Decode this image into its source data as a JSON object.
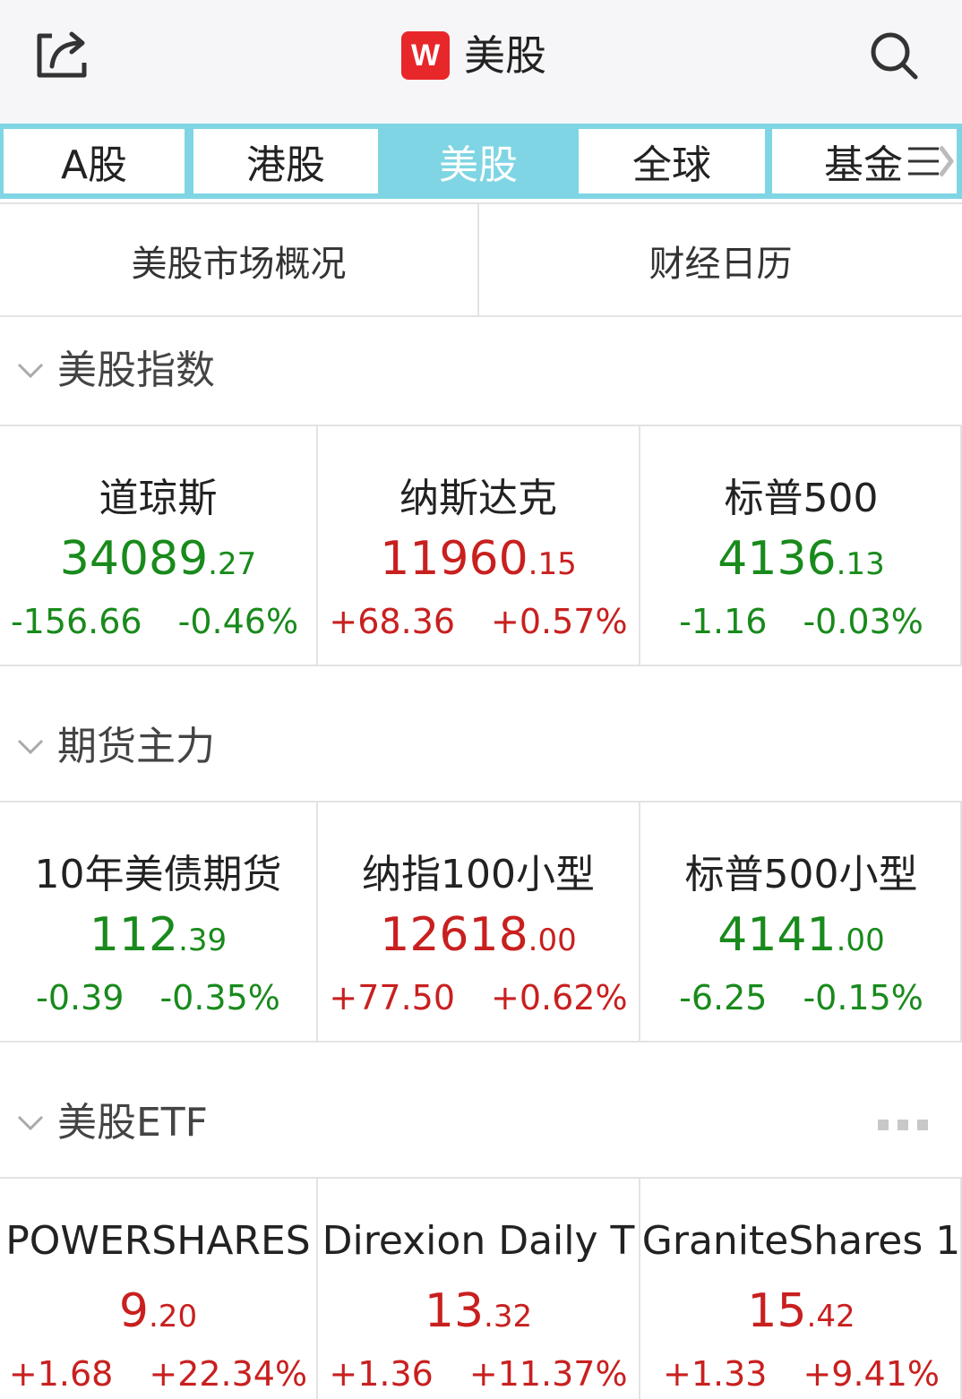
{
  "header": {
    "title": "美股",
    "logo_text": "W",
    "share_icon": "share-icon",
    "search_icon": "search-icon"
  },
  "tabs": [
    {
      "label": "A股",
      "active": false
    },
    {
      "label": "港股",
      "active": false
    },
    {
      "label": "美股",
      "active": true
    },
    {
      "label": "全球",
      "active": false
    },
    {
      "label": "基金",
      "active": false
    }
  ],
  "subnav": {
    "overview": "美股市场概况",
    "calendar": "财经日历"
  },
  "sections": {
    "indices": {
      "title": "美股指数",
      "items": [
        {
          "name": "道琼斯",
          "price_int": "34089",
          "price_dec": ".27",
          "change": "-156.66",
          "percent": "-0.46%",
          "direction": "down"
        },
        {
          "name": "纳斯达克",
          "price_int": "11960",
          "price_dec": ".15",
          "change": "+68.36",
          "percent": "+0.57%",
          "direction": "up"
        },
        {
          "name": "标普500",
          "price_int": "4136",
          "price_dec": ".13",
          "change": "-1.16",
          "percent": "-0.03%",
          "direction": "down"
        }
      ]
    },
    "futures": {
      "title": "期货主力",
      "items": [
        {
          "name": "10年美债期货",
          "price_int": "112",
          "price_dec": ".39",
          "change": "-0.39",
          "percent": "-0.35%",
          "direction": "down"
        },
        {
          "name": "纳指100小型",
          "price_int": "12618",
          "price_dec": ".00",
          "change": "+77.50",
          "percent": "+0.62%",
          "direction": "up"
        },
        {
          "name": "标普500小型",
          "price_int": "4141",
          "price_dec": ".00",
          "change": "-6.25",
          "percent": "-0.15%",
          "direction": "down"
        }
      ]
    },
    "etf": {
      "title": "美股ETF",
      "items": [
        {
          "name": "POWERSHARES",
          "price_int": "9",
          "price_dec": ".20",
          "change": "+1.68",
          "percent": "+22.34%",
          "direction": "up"
        },
        {
          "name": "Direxion Daily T",
          "price_int": "13",
          "price_dec": ".32",
          "change": "+1.36",
          "percent": "+11.37%",
          "direction": "up"
        },
        {
          "name": "GraniteShares 1",
          "price_int": "15",
          "price_dec": ".42",
          "change": "+1.33",
          "percent": "+9.41%",
          "direction": "up"
        }
      ]
    }
  },
  "colors": {
    "up": "#c8201f",
    "down": "#198a1c",
    "tab_accent": "#7fd5e3",
    "logo_bg": "#e8272b"
  }
}
